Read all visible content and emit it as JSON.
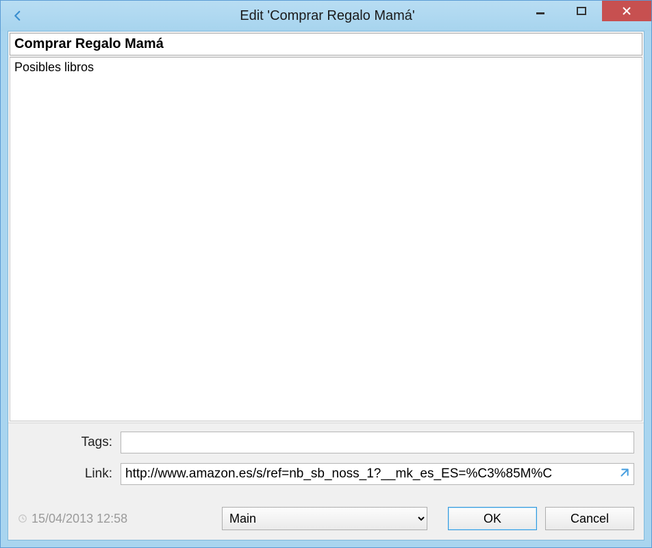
{
  "window": {
    "title": "Edit 'Comprar Regalo Mamá'"
  },
  "task": {
    "title": "Comprar Regalo Mamá",
    "notes": "Posibles libros"
  },
  "fields": {
    "tags_label": "Tags:",
    "tags_value": "",
    "link_label": "Link:",
    "link_value": "http://www.amazon.es/s/ref=nb_sb_noss_1?__mk_es_ES=%C3%85M%C"
  },
  "footer": {
    "timestamp": "15/04/2013 12:58",
    "list_selected": "Main",
    "ok_label": "OK",
    "cancel_label": "Cancel"
  }
}
